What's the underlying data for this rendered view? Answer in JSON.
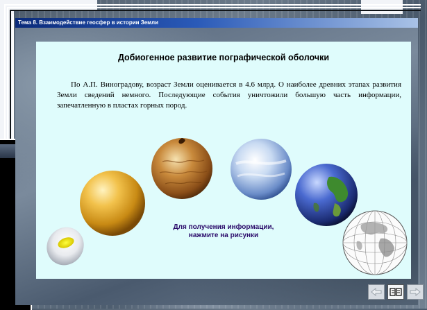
{
  "window": {
    "title": "Тема 8. Взаимодействие геосфер в истории Земли"
  },
  "slide": {
    "heading": "Добиогенное развитие пографической оболочки",
    "paragraph": "По А.П. Виноградову, возраст Земли оценивается в 4.6 млрд. О наиболее древних этапах развития Земли сведений немного.  Последующие события уничтожили большую часть информации, запечатленную в пластах горных пород.",
    "hint": "Для получения информации, нажмите на рисунки"
  },
  "navigation": {
    "prev_icon": "arrow-left-icon",
    "book_icon": "book-icon",
    "next_icon": "arrow-right-icon"
  },
  "colors": {
    "content_background": "#dffcfc",
    "title_bar_start": "#0a2a7a",
    "hint_text": "#2a0a6a"
  }
}
